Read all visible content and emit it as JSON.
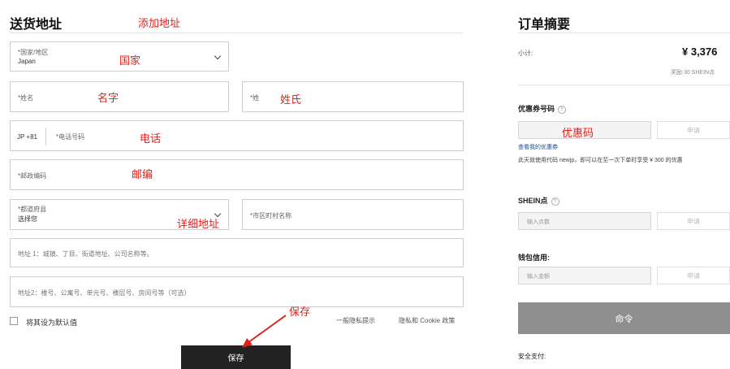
{
  "left": {
    "title": "送货地址",
    "country": {
      "label": "*国家/地区",
      "value": "Japan"
    },
    "last_name": {
      "label": "*姓名"
    },
    "first_name": {
      "label": "*姓"
    },
    "phone": {
      "prefix": "JP +81",
      "label": "*电话号码"
    },
    "postal": {
      "label": "*邮政编码"
    },
    "prefecture": {
      "label": "*都道府县",
      "value": "选择您"
    },
    "city": {
      "label": "*市区町村名称"
    },
    "address1": {
      "placeholder": "地址 1：城镇、丁目、街道地址、公司名称等。"
    },
    "address2": {
      "placeholder": "地址2：楼号、公寓号、单元号、楼层号、房间号等（可选）"
    },
    "default_checkbox_label": "将其设为默认值",
    "links": {
      "privacy_tip": "一般隐私提示",
      "cookie": "隐私和 Cookie 政策"
    },
    "save_button": "保存"
  },
  "annotations": {
    "add_address": "添加地址",
    "country": "国家",
    "name": "名字",
    "surname": "姓氏",
    "phone": "电话",
    "postal": "邮编",
    "detail_address": "详细地址",
    "save": "保存",
    "coupon": "优惠码"
  },
  "right": {
    "title": "订单摘要",
    "subtotal_label": "小计:",
    "subtotal_value": "¥ 3,376",
    "points_note": "奖励 30 SHEIN点",
    "coupon": {
      "title": "优惠券号码",
      "apply": "申请",
      "view_link": "查看我的优惠券",
      "note": "此天就使用代码 newjp，即可以在至一次下单时享受 ¥ 300 的优惠"
    },
    "points": {
      "title": "SHEIN点",
      "placeholder": "输入点数",
      "apply": "申请"
    },
    "wallet": {
      "title": "钱包信用:",
      "placeholder": "输入金额",
      "apply": "申请"
    },
    "order_button": "命令",
    "secure_pay": "安全支付:"
  },
  "colors": {
    "annotation": "#e0201b",
    "order_button": "#8f8f8f",
    "save_button": "#222222"
  }
}
